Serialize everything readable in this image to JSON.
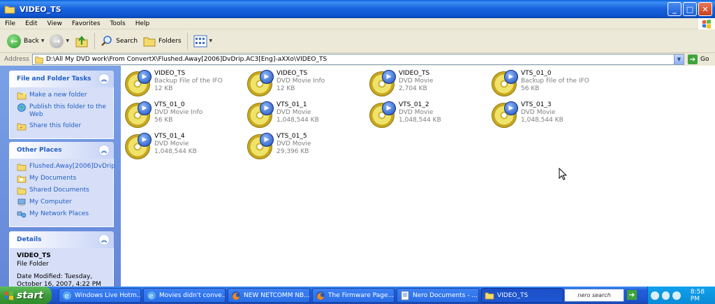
{
  "window": {
    "title": "VIDEO_TS"
  },
  "menu": [
    "File",
    "Edit",
    "View",
    "Favorites",
    "Tools",
    "Help"
  ],
  "toolbar": {
    "back": "Back",
    "search": "Search",
    "folders": "Folders"
  },
  "address": {
    "label": "Address",
    "value": "D:\\All My DVD work\\From ConvertX\\Flushed.Away[2006]DvDrip.AC3[Eng]-aXXo\\VIDEO_TS",
    "go": "Go"
  },
  "sidebar": {
    "tasks": {
      "title": "File and Folder Tasks",
      "items": [
        {
          "label": "Make a new folder"
        },
        {
          "label": "Publish this folder to the Web"
        },
        {
          "label": "Share this folder"
        }
      ]
    },
    "places": {
      "title": "Other Places",
      "items": [
        {
          "label": "Flushed.Away[2006]DvDrip"
        },
        {
          "label": "My Documents"
        },
        {
          "label": "Shared Documents"
        },
        {
          "label": "My Computer"
        },
        {
          "label": "My Network Places"
        }
      ]
    },
    "details": {
      "title": "Details",
      "name": "VIDEO_TS",
      "type": "File Folder",
      "modified": "Date Modified: Tuesday, October 16, 2007, 4:22 PM"
    }
  },
  "files": [
    {
      "name": "VIDEO_TS",
      "type": "Backup File of the IFO",
      "size": "12 KB"
    },
    {
      "name": "VIDEO_TS",
      "type": "DVD Movie Info",
      "size": "12 KB"
    },
    {
      "name": "VIDEO_TS",
      "type": "DVD Movie",
      "size": "2,704 KB"
    },
    {
      "name": "VTS_01_0",
      "type": "Backup File of the IFO",
      "size": "56 KB"
    },
    {
      "name": "VTS_01_0",
      "type": "DVD Movie Info",
      "size": "56 KB"
    },
    {
      "name": "VTS_01_1",
      "type": "DVD Movie",
      "size": "1,048,544 KB"
    },
    {
      "name": "VTS_01_2",
      "type": "DVD Movie",
      "size": "1,048,544 KB"
    },
    {
      "name": "VTS_01_3",
      "type": "DVD Movie",
      "size": "1,048,544 KB"
    },
    {
      "name": "VTS_01_4",
      "type": "DVD Movie",
      "size": "1,048,544 KB"
    },
    {
      "name": "VTS_01_5",
      "type": "DVD Movie",
      "size": "29,396 KB"
    }
  ],
  "taskbar": {
    "start": "start",
    "tasks": [
      {
        "label": "Windows Live Hotm..."
      },
      {
        "label": "Movies didn't conve..."
      },
      {
        "label": "NEW NETCOMM NB..."
      },
      {
        "label": "The Firmware Page..."
      },
      {
        "label": "Nero Documents - ..."
      },
      {
        "label": "VIDEO_TS"
      }
    ],
    "search": "nero search",
    "clock": "8:58 PM"
  }
}
